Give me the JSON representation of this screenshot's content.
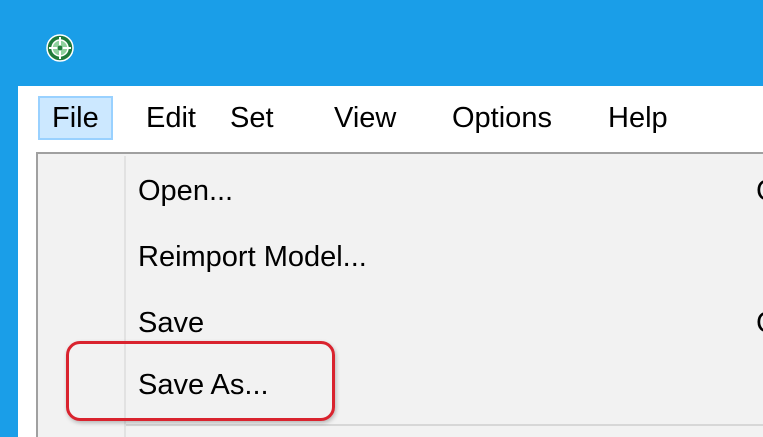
{
  "window": {
    "icon": "app-crosshair-icon",
    "accent_color": "#1a9ee8"
  },
  "menubar": {
    "items": [
      {
        "label": "File",
        "active": true
      },
      {
        "label": "Edit"
      },
      {
        "label": "Set"
      },
      {
        "label": "View"
      },
      {
        "label": "Options"
      },
      {
        "label": "Help"
      }
    ]
  },
  "file_menu": {
    "items": [
      {
        "label": "Open...",
        "shortcut": "C"
      },
      {
        "label": "Reimport Model...",
        "shortcut": ""
      },
      {
        "label": "Save",
        "shortcut": "C"
      },
      {
        "label": "Save As...",
        "shortcut": "",
        "highlighted": true
      }
    ]
  },
  "annotation": {
    "highlight_color": "#d9232e",
    "target": "Save As..."
  }
}
